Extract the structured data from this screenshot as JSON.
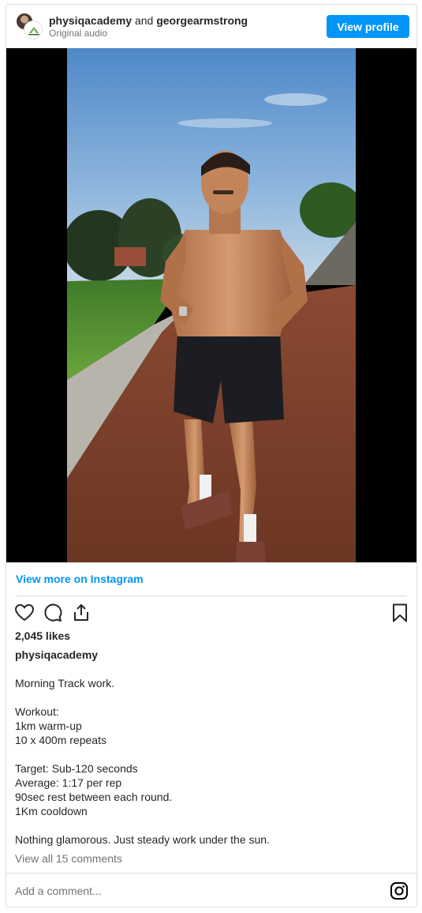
{
  "header": {
    "primary_user": "physiqacademy",
    "connector": "and",
    "collab_user": "georgearmstrong",
    "audio_label": "Original audio",
    "view_profile_label": "View profile"
  },
  "media": {
    "description_icon": "reel-video"
  },
  "view_more_label": "View more on Instagram",
  "actions": {
    "like_icon": "heart-icon",
    "comment_icon": "comment-icon",
    "share_icon": "share-icon",
    "save_icon": "bookmark-icon"
  },
  "likes_text": "2,045 likes",
  "caption_user": "physiqacademy",
  "caption_lines": [
    "Morning Track work.",
    "",
    "Workout:",
    "1km warm-up",
    "10 x 400m repeats",
    "",
    "Target: Sub-120 seconds",
    "Average: 1:17 per rep",
    "90sec rest between each round.",
    "1Km cooldown",
    "",
    "Nothing glamorous. Just steady work under the sun."
  ],
  "comments_link": "View all 15 comments",
  "comment_input": {
    "placeholder": "Add a comment...",
    "value": ""
  },
  "colors": {
    "accent": "#0095f6",
    "text": "#262626",
    "muted": "#737373",
    "border": "#dbdbdb"
  }
}
